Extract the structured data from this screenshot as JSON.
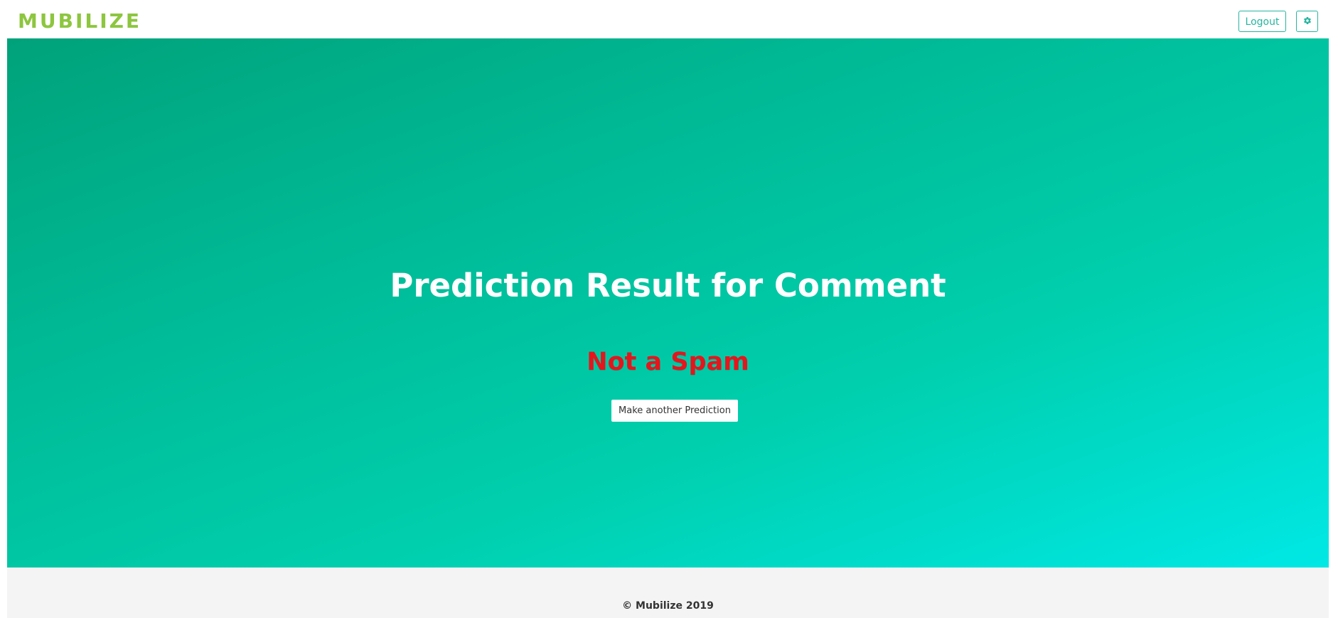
{
  "header": {
    "brand": "MUBILIZE",
    "logout_label": "Logout",
    "settings_icon": "gear-icon"
  },
  "main": {
    "title": "Prediction Result for Comment",
    "result": "Not a Spam",
    "button_label": "Make another Prediction"
  },
  "footer": {
    "text": "© Mubilize 2019"
  },
  "colors": {
    "brand": "#8dc63f",
    "accent": "#26b5a0",
    "result": "#e8141b",
    "gradient_start": "#00a27a",
    "gradient_end": "#00e8e5"
  }
}
